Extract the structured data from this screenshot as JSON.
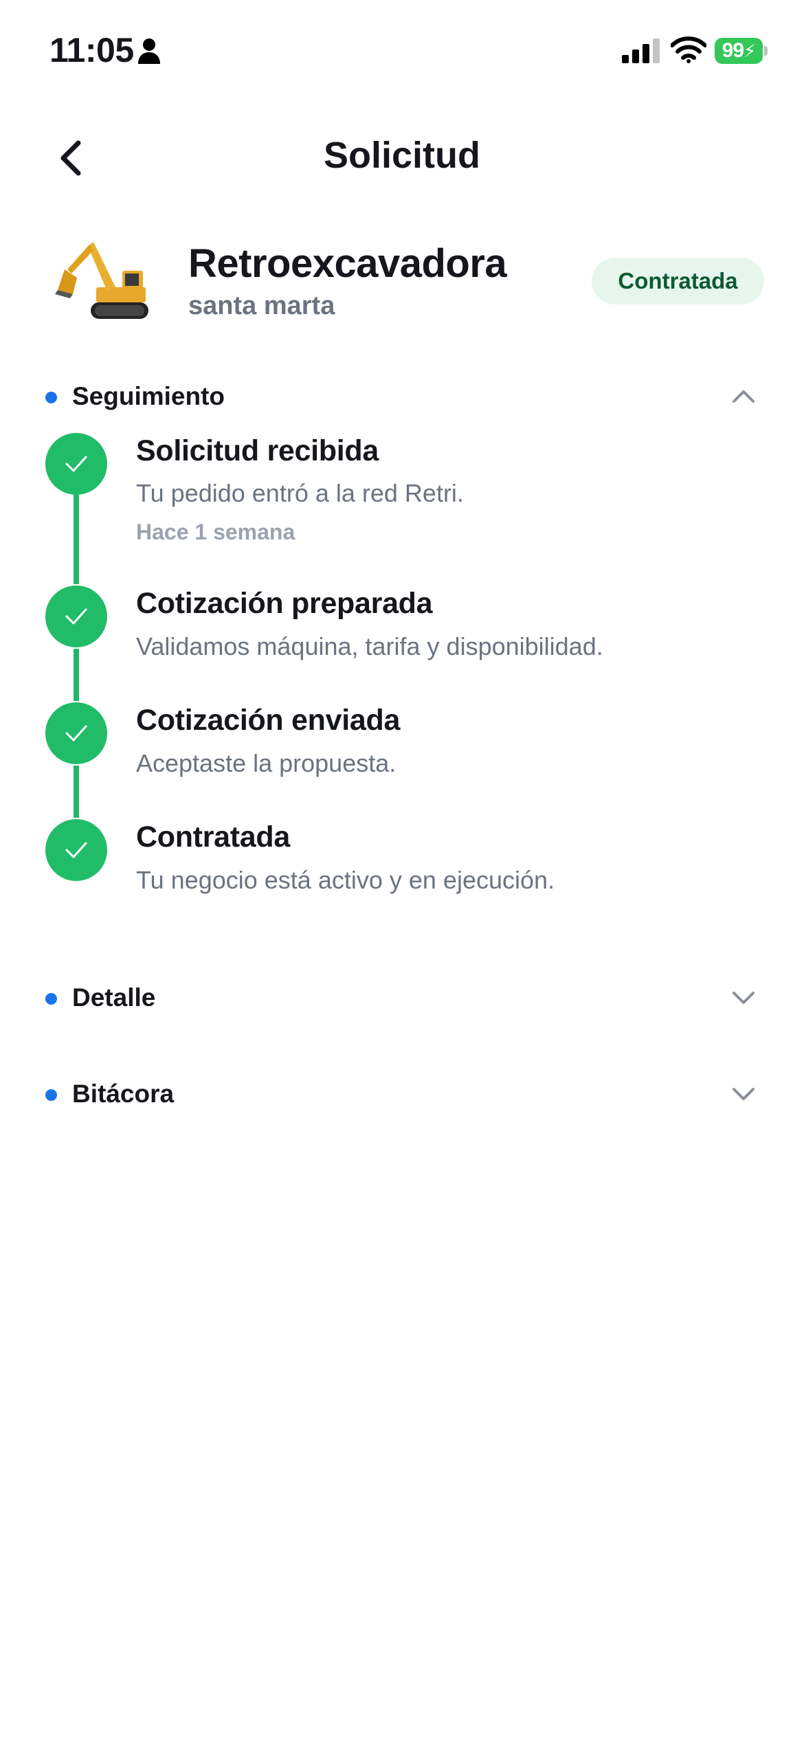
{
  "status_bar": {
    "time": "11:05",
    "battery": "99",
    "icons": [
      "person-icon",
      "cellular-signal-icon",
      "wifi-icon",
      "battery-charging-icon"
    ]
  },
  "header": {
    "title": "Solicitud",
    "back_icon": "chevron-left-icon"
  },
  "machine": {
    "name": "Retroexcavadora",
    "location": "santa marta",
    "status": "Contratada",
    "image": "excavator-illustration"
  },
  "sections": {
    "tracking": {
      "label": "Seguimiento",
      "expanded": true,
      "icon": "chevron-up-icon"
    },
    "detail": {
      "label": "Detalle",
      "expanded": false,
      "icon": "chevron-down-icon"
    },
    "log": {
      "label": "Bitácora",
      "expanded": false,
      "icon": "chevron-down-icon"
    }
  },
  "timeline": [
    {
      "title": "Solicitud recibida",
      "description": "Tu pedido entró a la red Retri.",
      "time": "Hace 1 semana",
      "done": true
    },
    {
      "title": "Cotización preparada",
      "description": "Validamos máquina, tarifa y disponibilidad.",
      "done": true
    },
    {
      "title": "Cotización enviada",
      "description": "Aceptaste la propuesta.",
      "done": true
    },
    {
      "title": "Contratada",
      "description": "Tu negocio está activo y en ejecución.",
      "done": true
    }
  ],
  "colors": {
    "accent_blue": "#1a73e8",
    "success_green": "#21bc68",
    "badge_bg": "#e7f6ed",
    "badge_text": "#0c5a32",
    "muted_text": "#6b7280"
  }
}
